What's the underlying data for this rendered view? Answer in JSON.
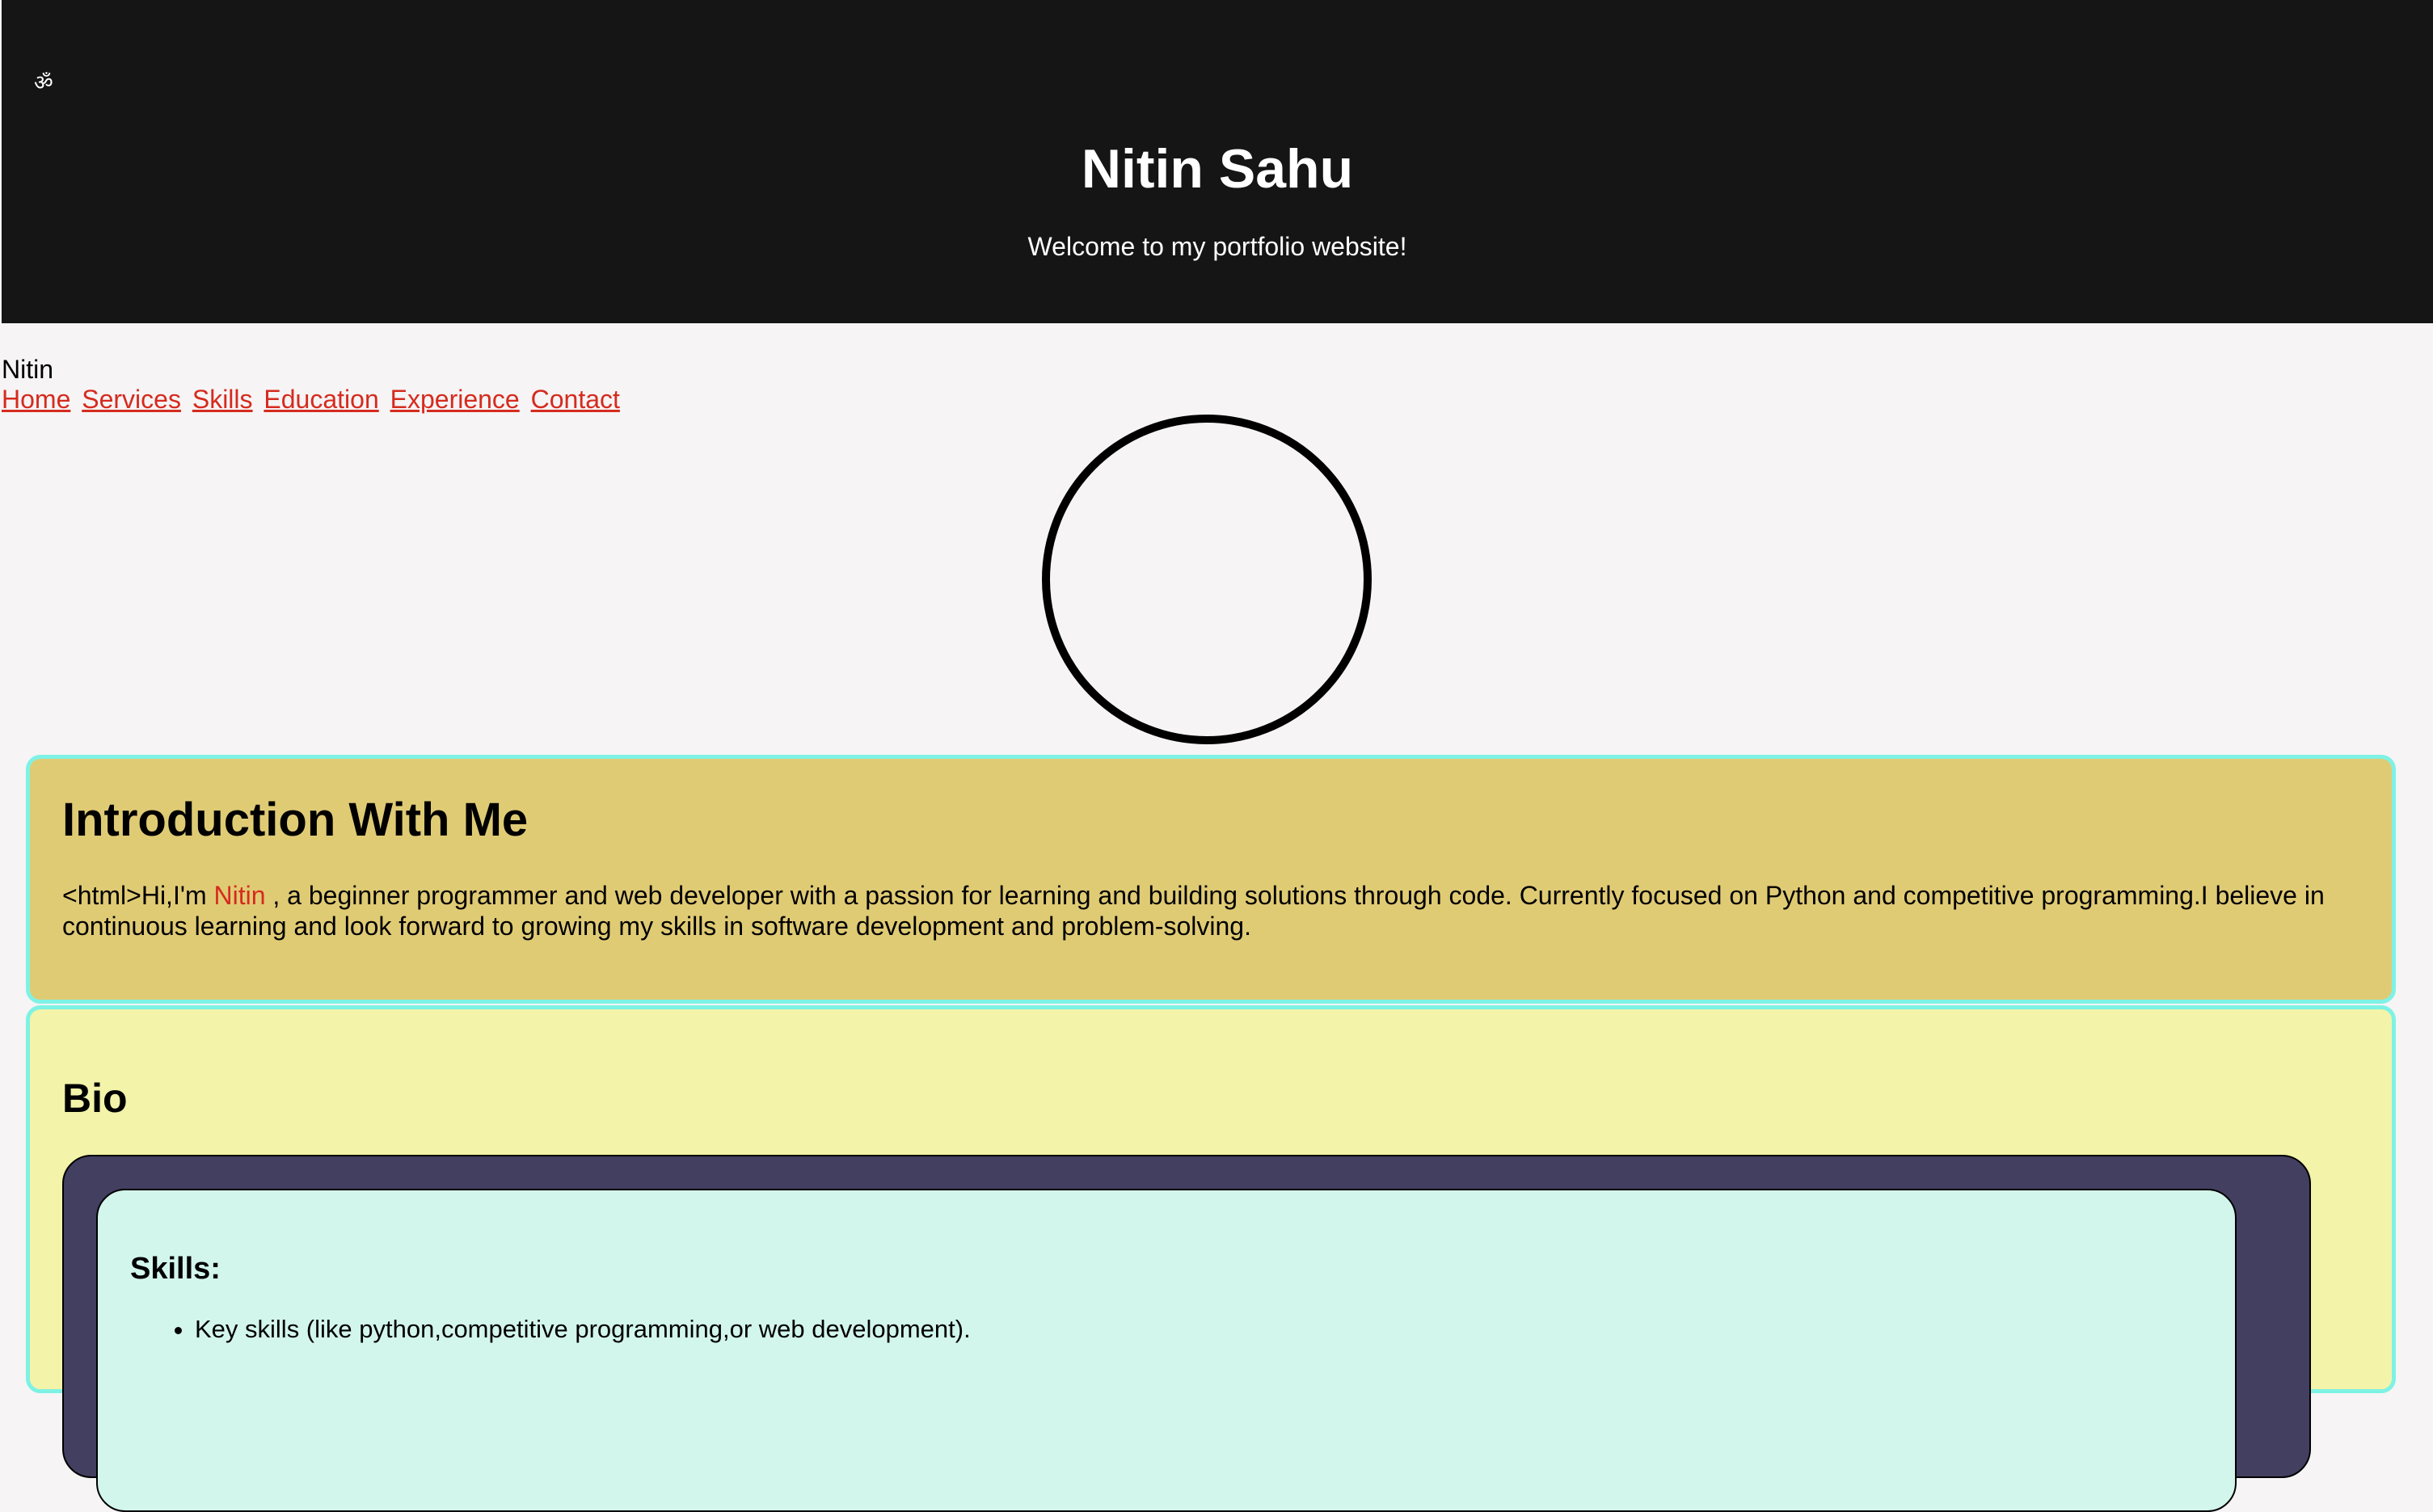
{
  "header": {
    "logo": "ॐ",
    "title": "Nitin Sahu",
    "subtitle": "Welcome to my portfolio website!"
  },
  "brand": "Nitin",
  "nav": {
    "items": [
      "Home",
      "Services",
      "Skills",
      "Education",
      "Experience",
      "Contact"
    ]
  },
  "intro": {
    "heading": "Introduction With Me",
    "text_before": "<html>Hi,I'm ",
    "name": "Nitin",
    "text_after": " , a beginner programmer and web developer with a passion for learning and building solutions through code. Currently focused on Python and competitive programming.I believe in continuous learning and look forward to growing my skills in software development and problem-solving."
  },
  "bio": {
    "heading": "Bio",
    "skills_heading": "Skills:",
    "skills": [
      "Key skills (like python,competitive programming,or web development)."
    ]
  },
  "colors": {
    "header_bg": "#151515",
    "page_bg": "#f6f4f5",
    "link": "#d52b1e",
    "intro_bg": "#e0cb75",
    "bio_bg": "#f3f3a9",
    "card_border": "#7ef2e4",
    "bio_outer_bg": "#433f60",
    "bio_inner_bg": "#d3f6ec"
  }
}
